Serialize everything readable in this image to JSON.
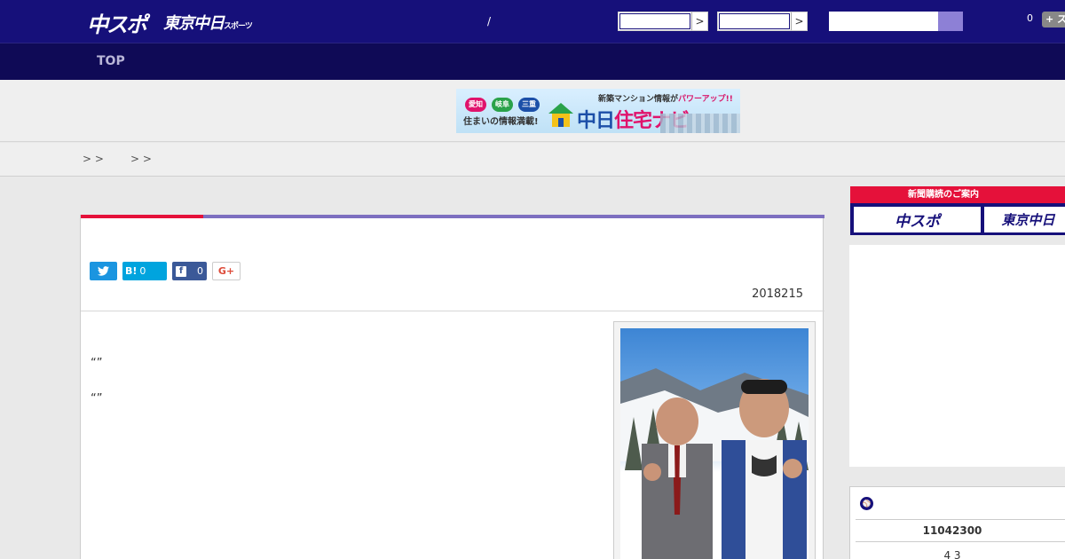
{
  "header": {
    "logo_main": "中スポ",
    "logo_sub": "東京中日",
    "logo_sub_small": "スポーツ",
    "slash": "/",
    "count": "0",
    "plus_label": "+ ス"
  },
  "nav": {
    "items": [
      {
        "label": "TOP"
      }
    ]
  },
  "banner": {
    "pills": [
      "愛知",
      "岐阜",
      "三重"
    ],
    "left_text": "住まいの情報満載!",
    "top_text": "新築マンション情報が",
    "top_emphasis": "パワーアップ!!",
    "brand_main": "中日",
    "brand_accent": "住宅ナビ"
  },
  "breadcrumb": {
    "items": [
      "> >",
      "> >"
    ]
  },
  "article": {
    "share": {
      "hatena_label": "B!",
      "hatena_count": "0",
      "facebook_count": "0",
      "gplus_label": "G+"
    },
    "date": "2018215",
    "quotes": [
      "“”",
      "“”"
    ]
  },
  "sidebar": {
    "subscribe_title": "新聞購読のご案内",
    "subscribe_buttons": [
      "中スポ",
      "東京中日"
    ],
    "scores": [
      "11042300",
      "4 3"
    ]
  },
  "colors": {
    "header": "#16107a",
    "nav": "#0f0a56",
    "accent_red": "#e5113a",
    "accent_purple": "#7d6fc0"
  }
}
